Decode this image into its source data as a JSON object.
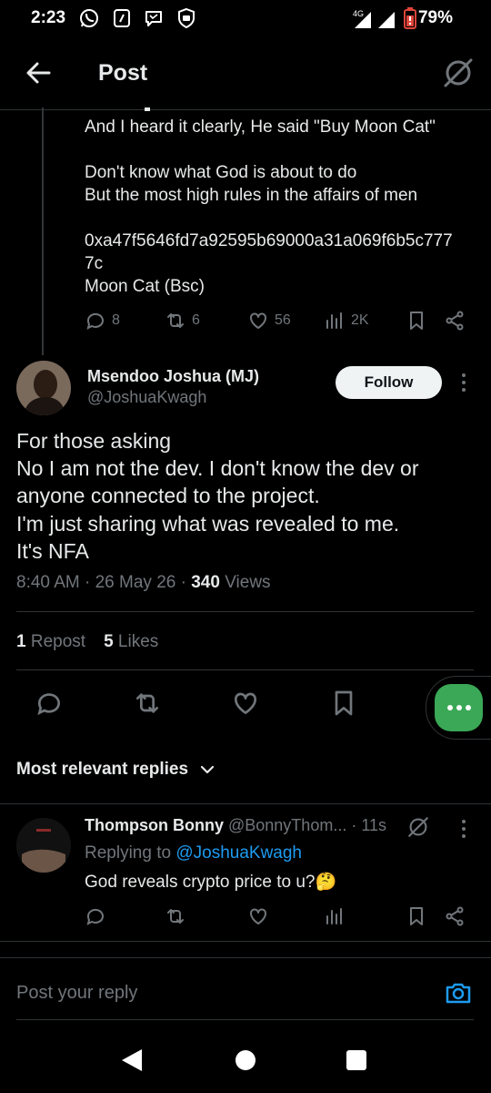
{
  "status_bar": {
    "time": "2:23",
    "network": "4G",
    "battery": "79%",
    "icons": [
      "whatsapp-icon",
      "notification-icon",
      "message-icon",
      "shield-icon",
      "signal-icon",
      "battery-icon"
    ]
  },
  "header": {
    "title": "Post",
    "back_icon": "arrow-left-icon",
    "grok_icon": "grok-icon"
  },
  "quoted_post": {
    "lines": [
      "And I heard it clearly, He said \"Buy Moon Cat\"",
      "",
      "Don't know what God is about to do",
      "But the most high rules in the affairs of men",
      "",
      "0xa47f5646fd7a92595b69000a31a069f6b5c777",
      "7c",
      "Moon Cat (Bsc)"
    ],
    "actions": {
      "replies": "8",
      "reposts": "6",
      "likes": "56",
      "views": "2K"
    }
  },
  "main_post": {
    "author_name": "Msendoo Joshua (MJ)",
    "author_handle": "@JoshuaKwagh",
    "follow_label": "Follow",
    "lines": [
      "For those asking",
      "No I am not the dev. I don't know the dev or",
      "anyone connected to the project.",
      "I'm just sharing what was revealed to me.",
      "It's NFA"
    ],
    "time": "8:40 AM",
    "date": "26 May 26",
    "views_count": "340",
    "views_label": "Views",
    "repost_count": "1",
    "repost_label": "Repost",
    "likes_count": "5",
    "likes_label": "Likes"
  },
  "sort": {
    "label": "Most relevant replies"
  },
  "reply": {
    "name": "Thompson Bonny",
    "handle": "@BonnyThom...",
    "time": "· 11s",
    "replying_prefix": "Replying to",
    "replying_handle": "@JoshuaKwagh",
    "text": "God reveals crypto price to u?🤔"
  },
  "composer": {
    "placeholder": "Post your reply"
  },
  "colors": {
    "background": "#000000",
    "text": "#e7e9ea",
    "muted": "#71767b",
    "link": "#1d9bf0",
    "divider": "#2f3336",
    "fab": "#3aa856"
  }
}
